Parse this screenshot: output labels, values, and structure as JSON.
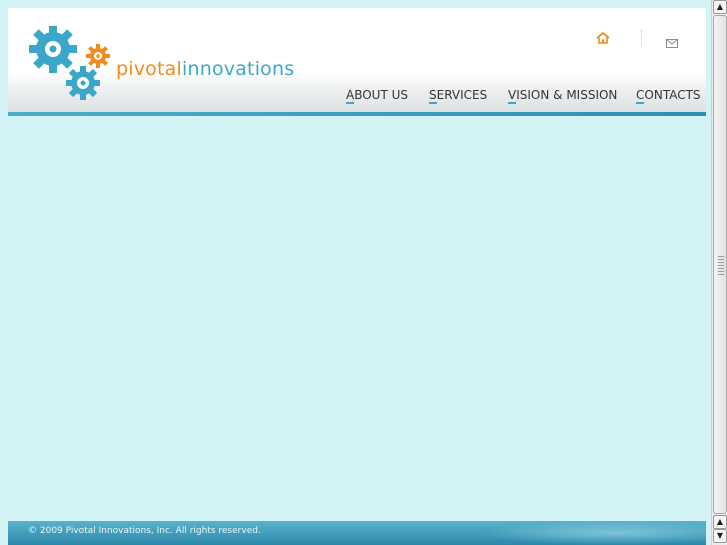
{
  "brand": {
    "logo_part1": "pivotal",
    "logo_part2": "innovations",
    "logo_icon": "gears-logo-icon"
  },
  "utility": {
    "home_icon": "home-icon",
    "mail_icon": "mail-icon"
  },
  "nav": {
    "items": [
      {
        "first_letter": "A",
        "rest": "BOUT US"
      },
      {
        "first_letter": "S",
        "rest": "ERVICES"
      },
      {
        "first_letter": "V",
        "rest": "ISION & MISSION"
      },
      {
        "first_letter": "C",
        "rest": "ONTACTS"
      }
    ]
  },
  "footer": {
    "copyright": "© 2009 Pivotal Innovations, Inc. All rights reserved."
  },
  "colors": {
    "page_background": "#d4f3f7",
    "brand_orange": "#f28a1d",
    "brand_blue": "#3ba7c8",
    "footer_blue": "#2d87a9"
  },
  "scrollbar": {
    "up_glyph": "▲",
    "down_glyph": "▼"
  }
}
